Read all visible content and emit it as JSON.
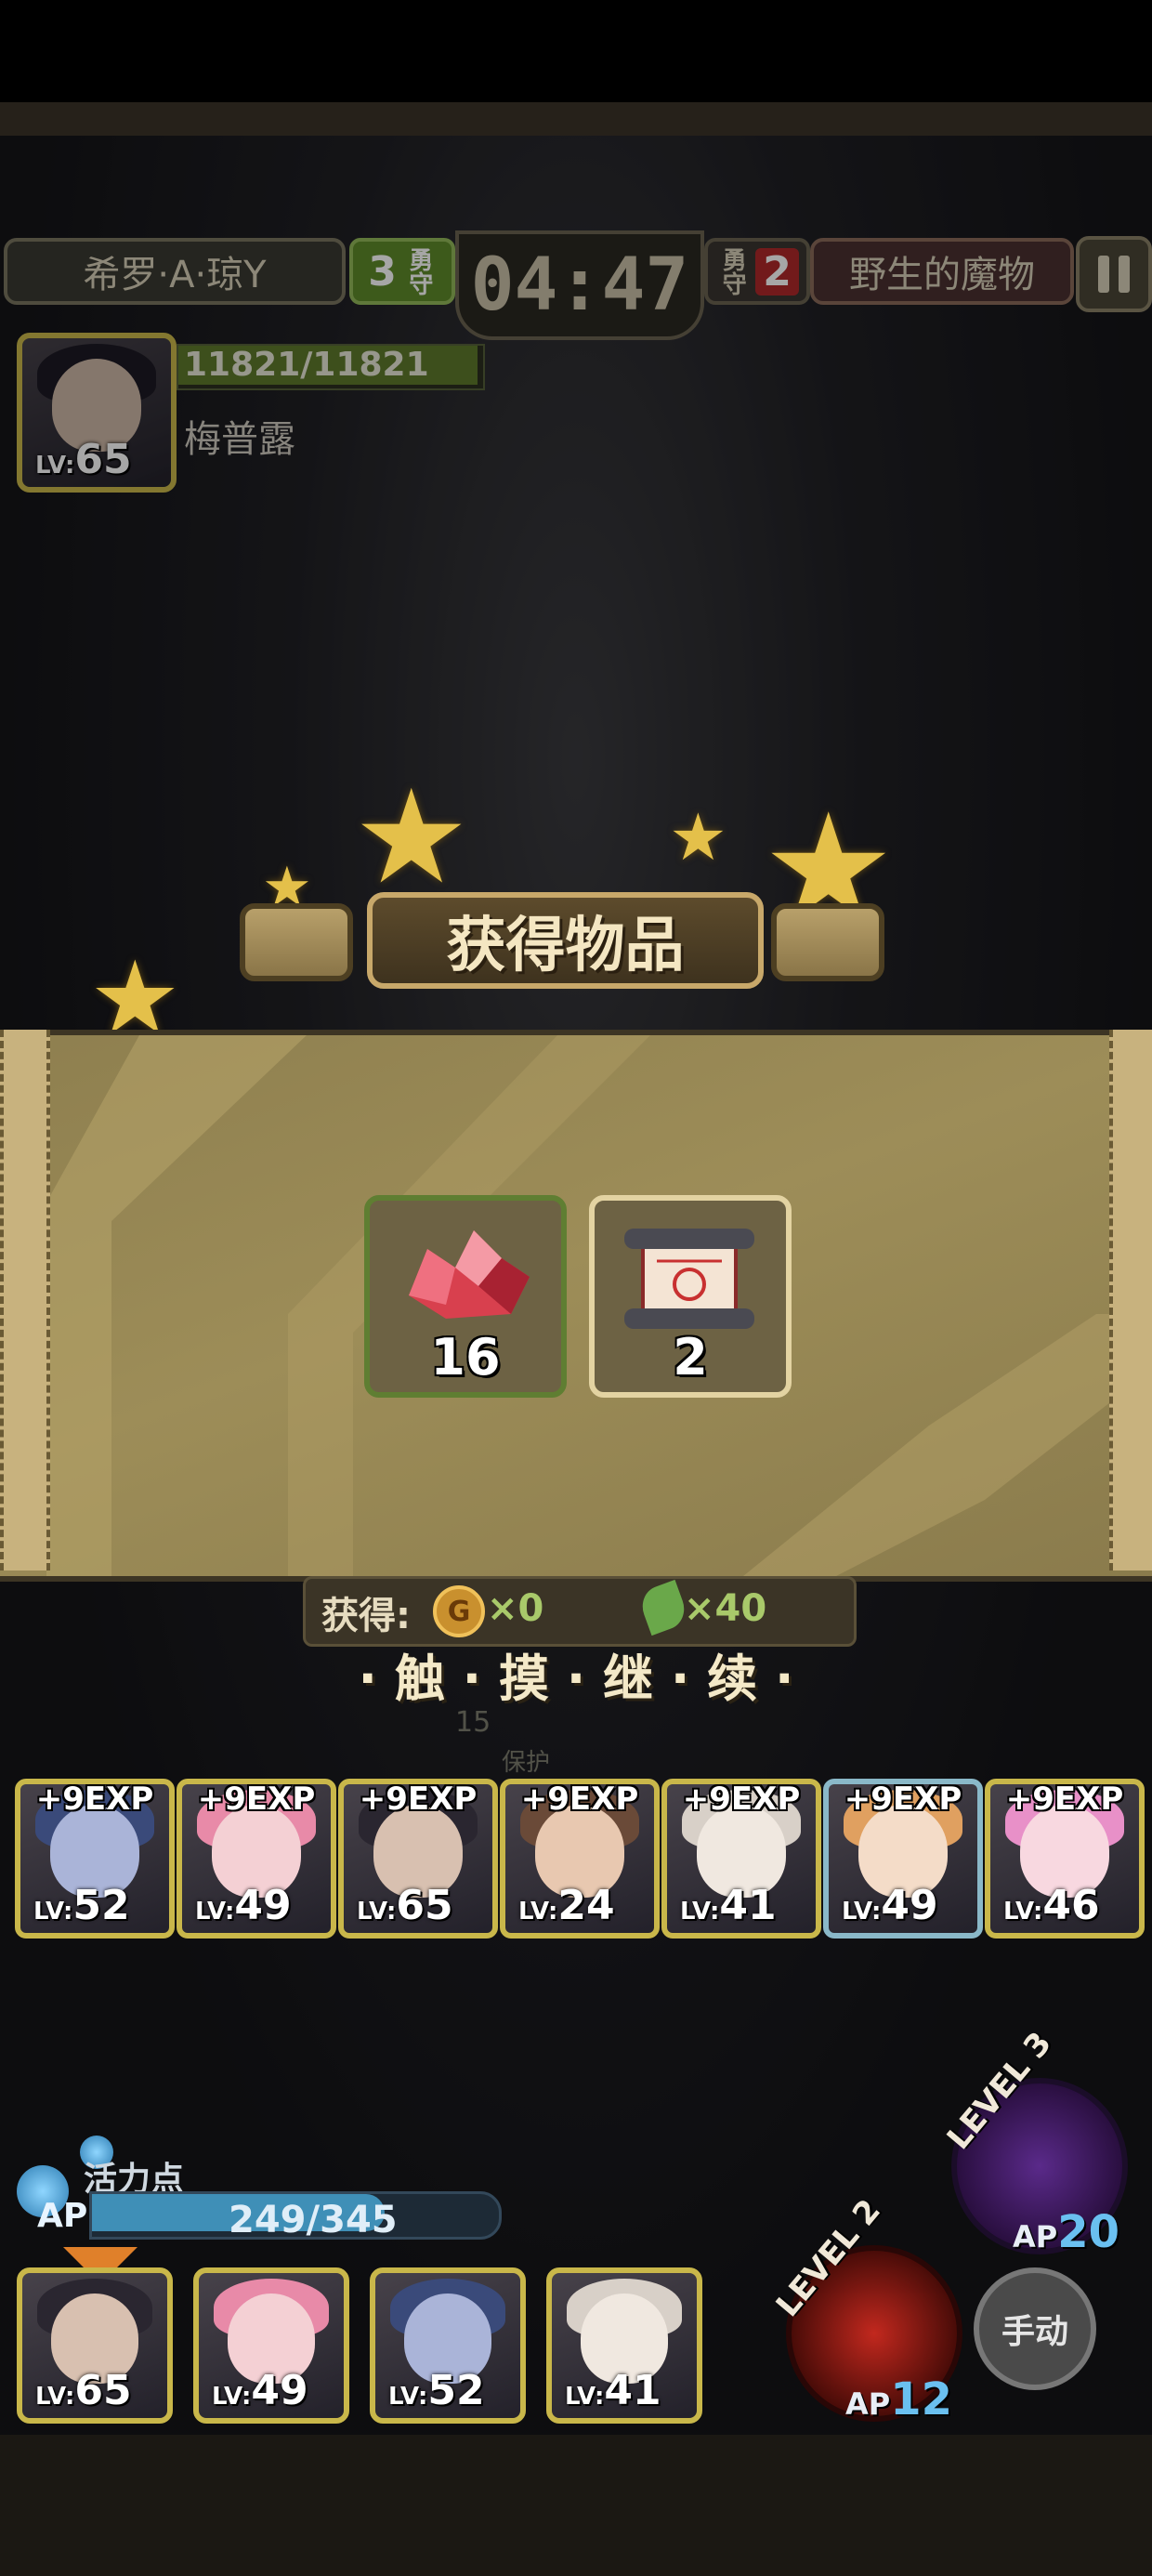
{
  "hud": {
    "left_team": "希罗·A·琼Y",
    "left_score": "3",
    "left_score_unit": "勇守",
    "timer": "04:47",
    "right_score_unit": "勇守",
    "right_score": "2",
    "right_team": "野生的魔物"
  },
  "boss": {
    "level_tag": "LV:",
    "level": "65",
    "hp": "11821/11821",
    "name": "梅普露"
  },
  "reward": {
    "title": "获得物品",
    "items": [
      {
        "icon": "red-crystal-icon",
        "count": "16"
      },
      {
        "icon": "scroll-icon",
        "count": "2"
      }
    ],
    "gain_label": "获得:",
    "coin_text": "×0",
    "leaf_text": "×40",
    "continue_text": "· 触 · 摸 · 继 · 续 ·"
  },
  "background_hint": {
    "level": "15",
    "status": "保护"
  },
  "party": {
    "exp_label": "+9EXP",
    "members": [
      {
        "level": "52"
      },
      {
        "level": "49"
      },
      {
        "level": "65"
      },
      {
        "level": "24"
      },
      {
        "level": "41"
      },
      {
        "level": "49"
      },
      {
        "level": "46"
      }
    ]
  },
  "ap": {
    "label": "活力点",
    "tag": "AP",
    "value": "249/345",
    "fraction": 0.72
  },
  "skills": {
    "skill_a_level": "LEVEL 3",
    "skill_a_ap_tag": "AP",
    "skill_a_ap": "20",
    "skill_b_level": "LEVEL 2",
    "skill_b_ap_tag": "AP",
    "skill_b_ap": "12",
    "manual_label": "手动"
  },
  "squad": {
    "members": [
      {
        "level": "65"
      },
      {
        "level": "49"
      },
      {
        "level": "52"
      },
      {
        "level": "41"
      }
    ]
  },
  "colors": {
    "accent_gold": "#c9b74a",
    "panel_tan": "#9d8d58",
    "left_score_green": "#5f8a2a",
    "right_score_red": "#b0282a"
  }
}
